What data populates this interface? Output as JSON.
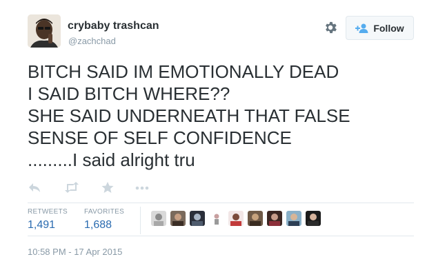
{
  "user": {
    "name": "crybaby trashcan",
    "handle": "@zachchad"
  },
  "follow_button": {
    "label": "Follow"
  },
  "tweet": {
    "lines": [
      "BITCH SAID IM EMOTIONALLY DEAD",
      "I SAID BITCH WHERE??",
      "SHE SAID UNDERNEATH THAT FALSE",
      "SENSE OF SELF CONFIDENCE",
      ".........I said alright tru"
    ]
  },
  "actions": {
    "icons": [
      "reply-icon",
      "retweet-icon",
      "favorite-icon",
      "more-icon"
    ]
  },
  "stats": {
    "retweets_label": "RETWEETS",
    "retweets_value": "1,491",
    "favorites_label": "FAVORITES",
    "favorites_value": "1,688"
  },
  "timestamp": "10:58 PM - 17 Apr 2015",
  "colors": {
    "text": "#292f33",
    "muted": "#8899a6",
    "stat_value": "#2a6bb0",
    "follow_icon": "#55acee",
    "border": "#e1e8ed"
  }
}
